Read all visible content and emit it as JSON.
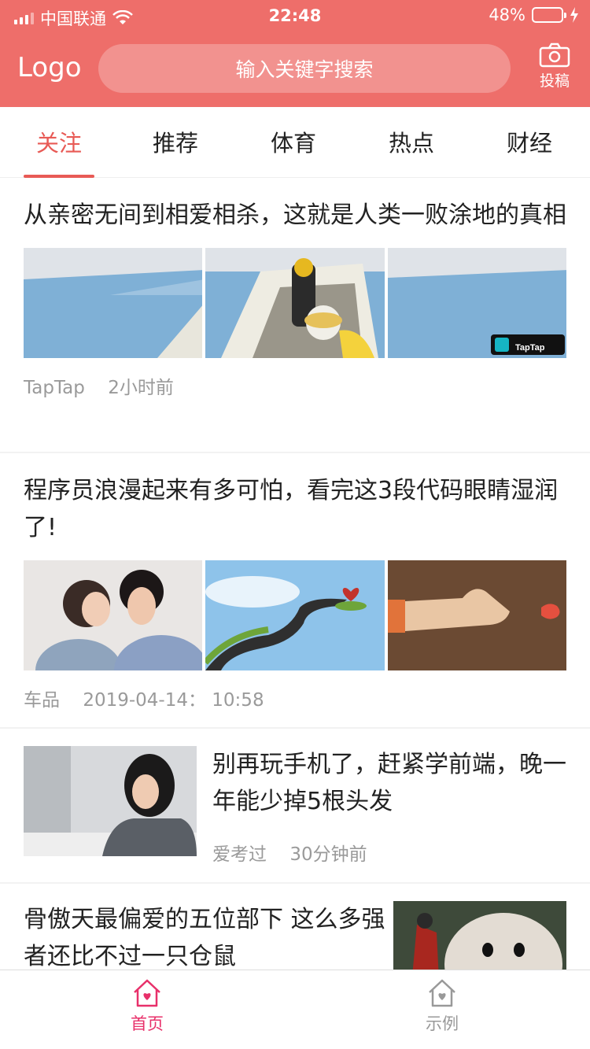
{
  "status": {
    "carrier": "中国联通",
    "time": "22:48",
    "battery": "48%",
    "battery_level": 0.48
  },
  "header": {
    "logo": "Logo",
    "search_placeholder": "输入关键字搜索",
    "post_label": "投稿"
  },
  "tabs": [
    {
      "label": "关注",
      "active": true
    },
    {
      "label": "推荐",
      "active": false
    },
    {
      "label": "体育",
      "active": false
    },
    {
      "label": "热点",
      "active": false
    },
    {
      "label": "财经",
      "active": false
    }
  ],
  "articles": [
    {
      "title": "从亲密无间到相爱相杀，这就是人类一败涂地的真相",
      "source": "TapTap",
      "time": "2小时前",
      "watermark": "TapTap"
    },
    {
      "title": "程序员浪漫起来有多可怕，看完这3段代码眼睛湿润了!",
      "source": "车品",
      "time": "2019-04-14： 10:58"
    },
    {
      "title": "别再玩手机了，赶紧学前端，晚一年能少掉5根头发",
      "source": "爱考过",
      "time": "30分钟前"
    },
    {
      "title": "骨傲天最偏爱的五位部下 这么多强者还比不过一只仓鼠"
    }
  ],
  "tabbar": [
    {
      "label": "首页",
      "active": true,
      "color": "#e8306a"
    },
    {
      "label": "示例",
      "active": false,
      "color": "#999999"
    }
  ]
}
